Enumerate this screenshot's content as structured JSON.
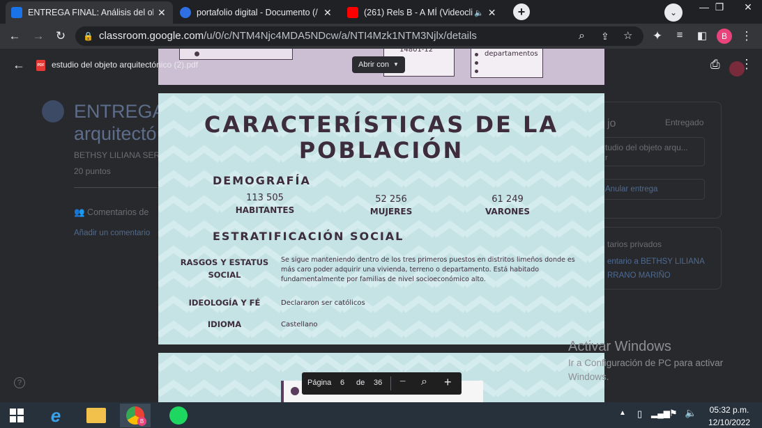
{
  "browser": {
    "tabs": [
      {
        "title": "ENTREGA FINAL: Análisis del obje",
        "active": true,
        "favicon_color": "#1a73e8"
      },
      {
        "title": "portafolio digital - Documento (/",
        "active": false,
        "favicon_color": "#2f6fe4"
      },
      {
        "title": "(261) Rels B - A MÍ (Videoclip",
        "active": false,
        "favicon_color": "#ff0000"
      }
    ],
    "url_host": "classroom.google.com",
    "url_path": "/u/0/c/NTM4Njc4MDA5NDcw/a/NTI4Mzk1NTM3Njlx/details",
    "profile_initial": "B"
  },
  "classroom": {
    "title_line1": "ENTREGA",
    "title_line2": "arquitectó",
    "author": "BETHSY LILIANA SER",
    "points": "20 puntos",
    "comments_label": "Comentarios de",
    "add_comment": "Añadir un comentario",
    "side_tail": "jo",
    "status": "Entregado",
    "attachment": "tudio del objeto arqu...",
    "attachment_tail": "r",
    "unsubmit": "Anular entrega",
    "private_comments": "tarios privados",
    "private_to_line1": "entario a BETHSY LILIANA",
    "private_to_line2": "RRANO MARIÑO",
    "help": "?"
  },
  "viewer": {
    "filename": "estudio del objeto arquitectónico (2).pdf",
    "file_badge": "PDF",
    "open_with": "Abrir con",
    "prev_page_fragments": [
      "14801-12",
      "departamentos"
    ],
    "page_label": "Página",
    "page_current": "6",
    "page_of": "de",
    "page_total": "36"
  },
  "slide": {
    "title_line1": "CARACTERÍSTICAS DE LA",
    "title_line2": "POBLACIÓN",
    "demografia_heading": "DEMOGRAFÍA",
    "stats": [
      {
        "value": "113 505",
        "label": "HABITANTES"
      },
      {
        "value": "52 256",
        "label": "MUJERES"
      },
      {
        "value": "61 249",
        "label": "VARONES"
      }
    ],
    "estratificacion_heading": "ESTRATIFICACIÓN SOCIAL",
    "rows": [
      {
        "label_line1": "RASGOS Y ESTATUS",
        "label_line2": "SOCIAL",
        "text": "Se sigue manteniendo dentro de los tres primeros puestos en distritos limeños donde es más caro poder adquirir una vivienda, terreno o departamento. Está habitado fundamentalmente por familias de nivel socioeconómico alto."
      },
      {
        "label_line1": "IDEOLOGÍA Y FÉ",
        "label_line2": "",
        "text": "Declararon ser católicos"
      },
      {
        "label_line1": "IDIOMA",
        "label_line2": "",
        "text": "Castellano"
      }
    ]
  },
  "watermark": {
    "line1": "Activar Windows",
    "line2": "Ir a Configuración de PC para activar",
    "line3": "Windows."
  },
  "taskbar": {
    "time": "05:32 p.m.",
    "date": "12/10/2022",
    "chrome_badge": "B"
  }
}
